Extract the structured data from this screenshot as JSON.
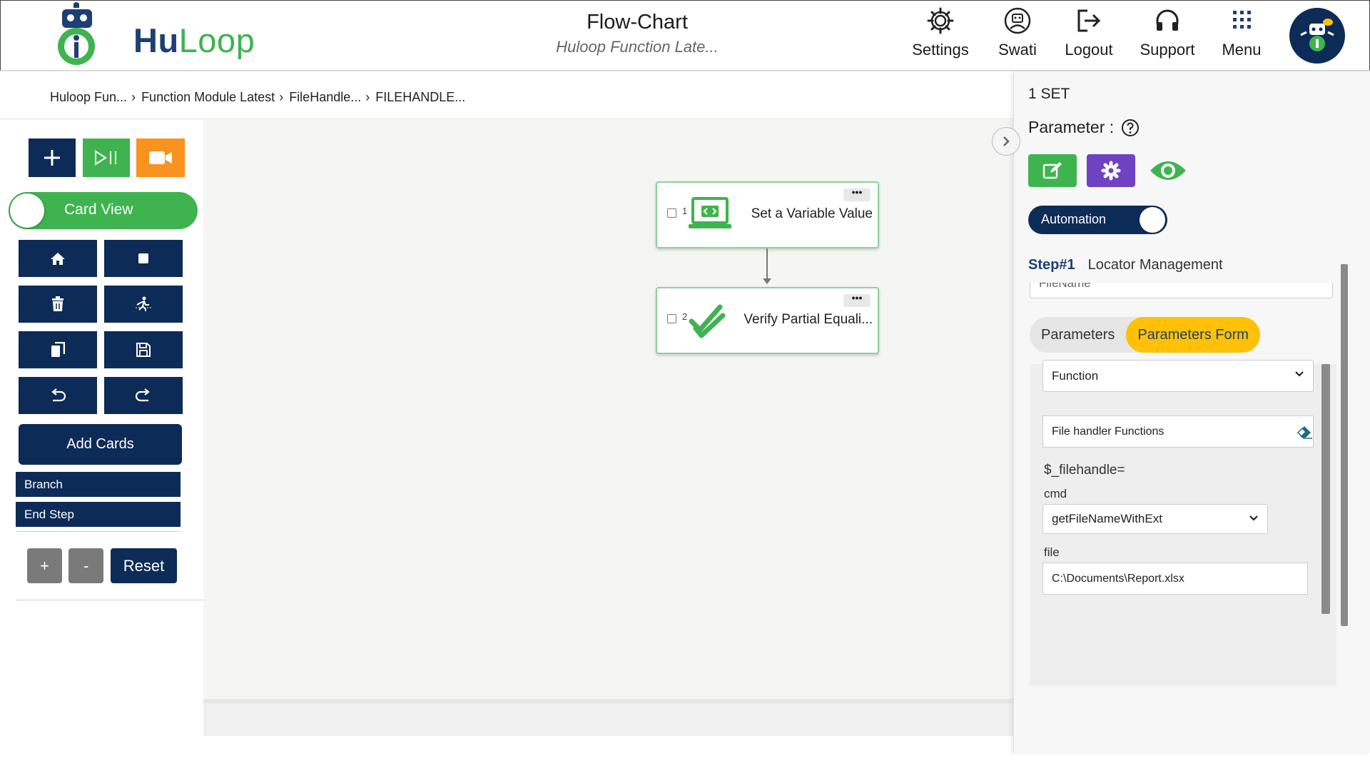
{
  "header": {
    "logo_hu": "Hu",
    "logo_loop": "Loop",
    "title": "Flow-Chart",
    "subtitle": "Huloop Function Late...",
    "nav": {
      "settings": "Settings",
      "user": "Swati",
      "logout": "Logout",
      "support": "Support",
      "menu": "Menu"
    }
  },
  "breadcrumb": [
    "Huloop Fun...",
    "Function Module Latest",
    "FileHandle...",
    "FILEHANDLE..."
  ],
  "toolbar": {
    "card_view_label": "Card View",
    "add_cards_label": "Add Cards",
    "branch_label": "Branch",
    "end_step_label": "End Step",
    "zoom_in_label": "+",
    "zoom_out_label": "-",
    "reset_label": "Reset"
  },
  "flow": {
    "nodes": [
      {
        "number": "1",
        "label": "Set a Variable Value",
        "icon": "code-monitor-icon"
      },
      {
        "number": "2",
        "label": "Verify Partial Equali...",
        "icon": "double-check-icon"
      }
    ],
    "menu_dots": "•••"
  },
  "panel": {
    "set_label": "1 SET",
    "parameter_label": "Parameter :",
    "automation_label": "Automation",
    "step_number": "Step#1",
    "step_title": "Locator Management",
    "cut_field_text": "FileName",
    "tabs": {
      "parameters": "Parameters",
      "parameters_form": "Parameters Form"
    },
    "function_select": "Function",
    "module_value": "File handler Functions",
    "variable_label": "$_filehandle=",
    "cmd_label": "cmd",
    "cmd_value": "getFileNameWithExt",
    "file_label": "file",
    "file_value": "C:\\Documents\\Report.xlsx"
  },
  "colors": {
    "navy": "#0d2b57",
    "green": "#3fb34f",
    "orange": "#f7931e",
    "purple": "#6f42c1",
    "yellow": "#ffc107"
  }
}
